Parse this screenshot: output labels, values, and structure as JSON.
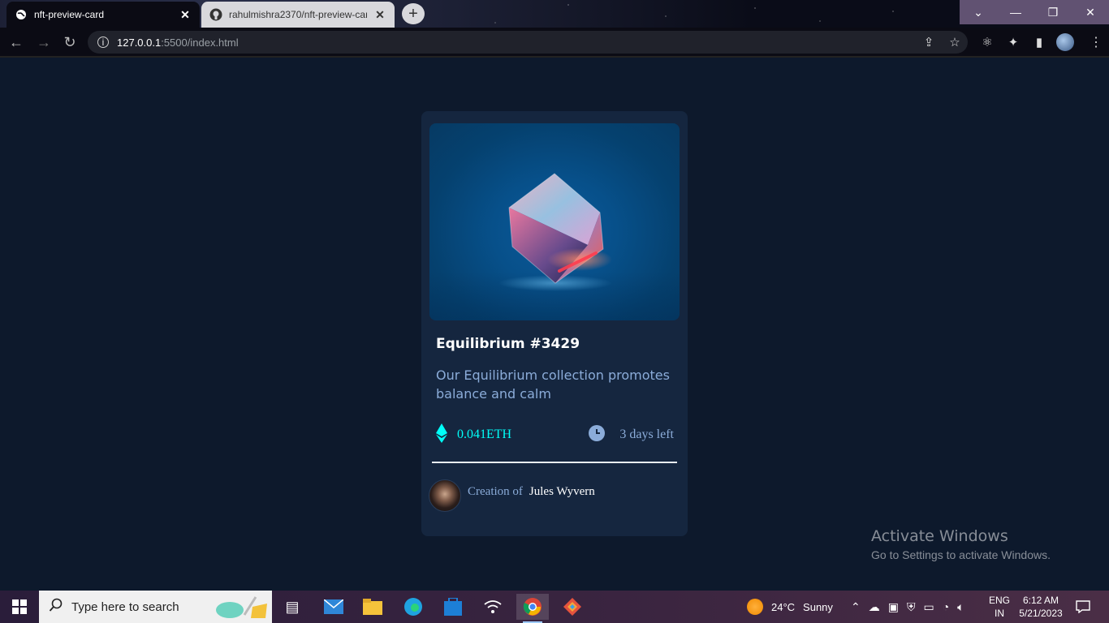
{
  "browser": {
    "tabs": [
      {
        "title": "nft-preview-card",
        "active": true,
        "icon": "globe-icon"
      },
      {
        "title": "rahulmishra2370/nft-preview-card",
        "active": false,
        "icon": "github-icon"
      }
    ],
    "address": {
      "host": "127.0.0.1",
      "path": ":5500/index.html"
    },
    "window_controls": [
      "chevron-down-icon",
      "minimize-icon",
      "restore-icon",
      "close-icon"
    ],
    "toolbar_icons": [
      "back-icon",
      "forward-icon",
      "reload-icon",
      "info-icon",
      "share-icon",
      "star-icon",
      "react-extension-icon",
      "puzzle-icon",
      "sidebar-icon",
      "profile-avatar",
      "more-icon"
    ]
  },
  "card": {
    "title": "Equilibrium #3429",
    "description": "Our Equilibrium collection promotes balance and calm",
    "price": "0.041ETH",
    "time_left": "3 days left",
    "creator_label": "Creation of",
    "creator_name": "Jules Wyvern",
    "accent_color": "#00fff8",
    "soft_blue": "#8bacd9"
  },
  "watermark": {
    "line1": "Activate Windows",
    "line2": "Go to Settings to activate Windows."
  },
  "taskbar": {
    "search_placeholder": "Type here to search",
    "pinned": [
      "task-view-icon",
      "mail-icon",
      "file-explorer-icon",
      "edge-icon",
      "store-icon",
      "wifi-icon",
      "chrome-icon",
      "git-icon"
    ],
    "weather": {
      "temp": "24°C",
      "condition": "Sunny"
    },
    "language": {
      "line1": "ENG",
      "line2": "IN"
    },
    "clock": {
      "time": "6:12 AM",
      "date": "5/21/2023"
    }
  }
}
